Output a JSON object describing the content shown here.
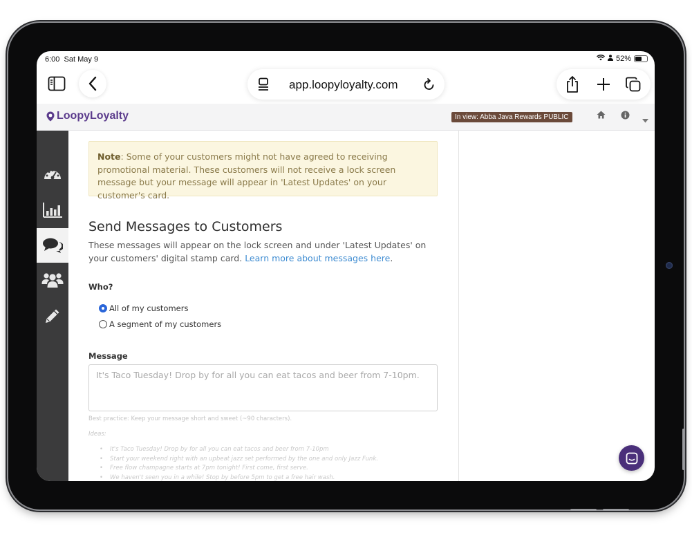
{
  "status_bar": {
    "time": "6:00",
    "date": "Sat May 9",
    "battery": "52%"
  },
  "browser": {
    "url": "app.loopyloyalty.com"
  },
  "app": {
    "logo_text": "LoopyLoyalty",
    "in_view_badge": "In view: Abba Java Rewards PUBLIC"
  },
  "note": {
    "label": "Note",
    "text": ": Some of your customers might not have agreed to receiving promotional material. These customers will not receive a lock screen message but your message will appear in 'Latest Updates' on your customer's card."
  },
  "section": {
    "title": "Send Messages to Customers",
    "description": "These messages will appear on the lock screen and under 'Latest Updates' on your customers' digital stamp card. ",
    "learn_more": "Learn more about messages here",
    "period": "."
  },
  "who": {
    "label": "Who?",
    "options": [
      {
        "label": "All of my customers",
        "checked": true
      },
      {
        "label": "A segment of my customers",
        "checked": false
      }
    ]
  },
  "message": {
    "label": "Message",
    "placeholder": "It's Taco Tuesday! Drop by for all you can eat tacos and beer from 7-10pm.",
    "best_practice": "Best practice: Keep your message short and sweet (~90 characters).",
    "ideas_label": "Ideas:",
    "ideas": [
      "It's Taco Tuesday! Drop by for all you can eat tacos and beer from 7-10pm",
      "Start your weekend right with an upbeat jazz set performed by the one and only Jazz Funk.",
      "Free flow champagne starts at 7pm tonight! First come, first serve.",
      "We haven't seen you in a while! Stop by before 5pm to get a free hair wash."
    ]
  },
  "colors": {
    "brand": "#5b3b8c",
    "sidebar": "#3b3b3c",
    "note_bg": "#fbf6e0",
    "link": "#3d8bd1",
    "badge": "#6b4a3a"
  }
}
